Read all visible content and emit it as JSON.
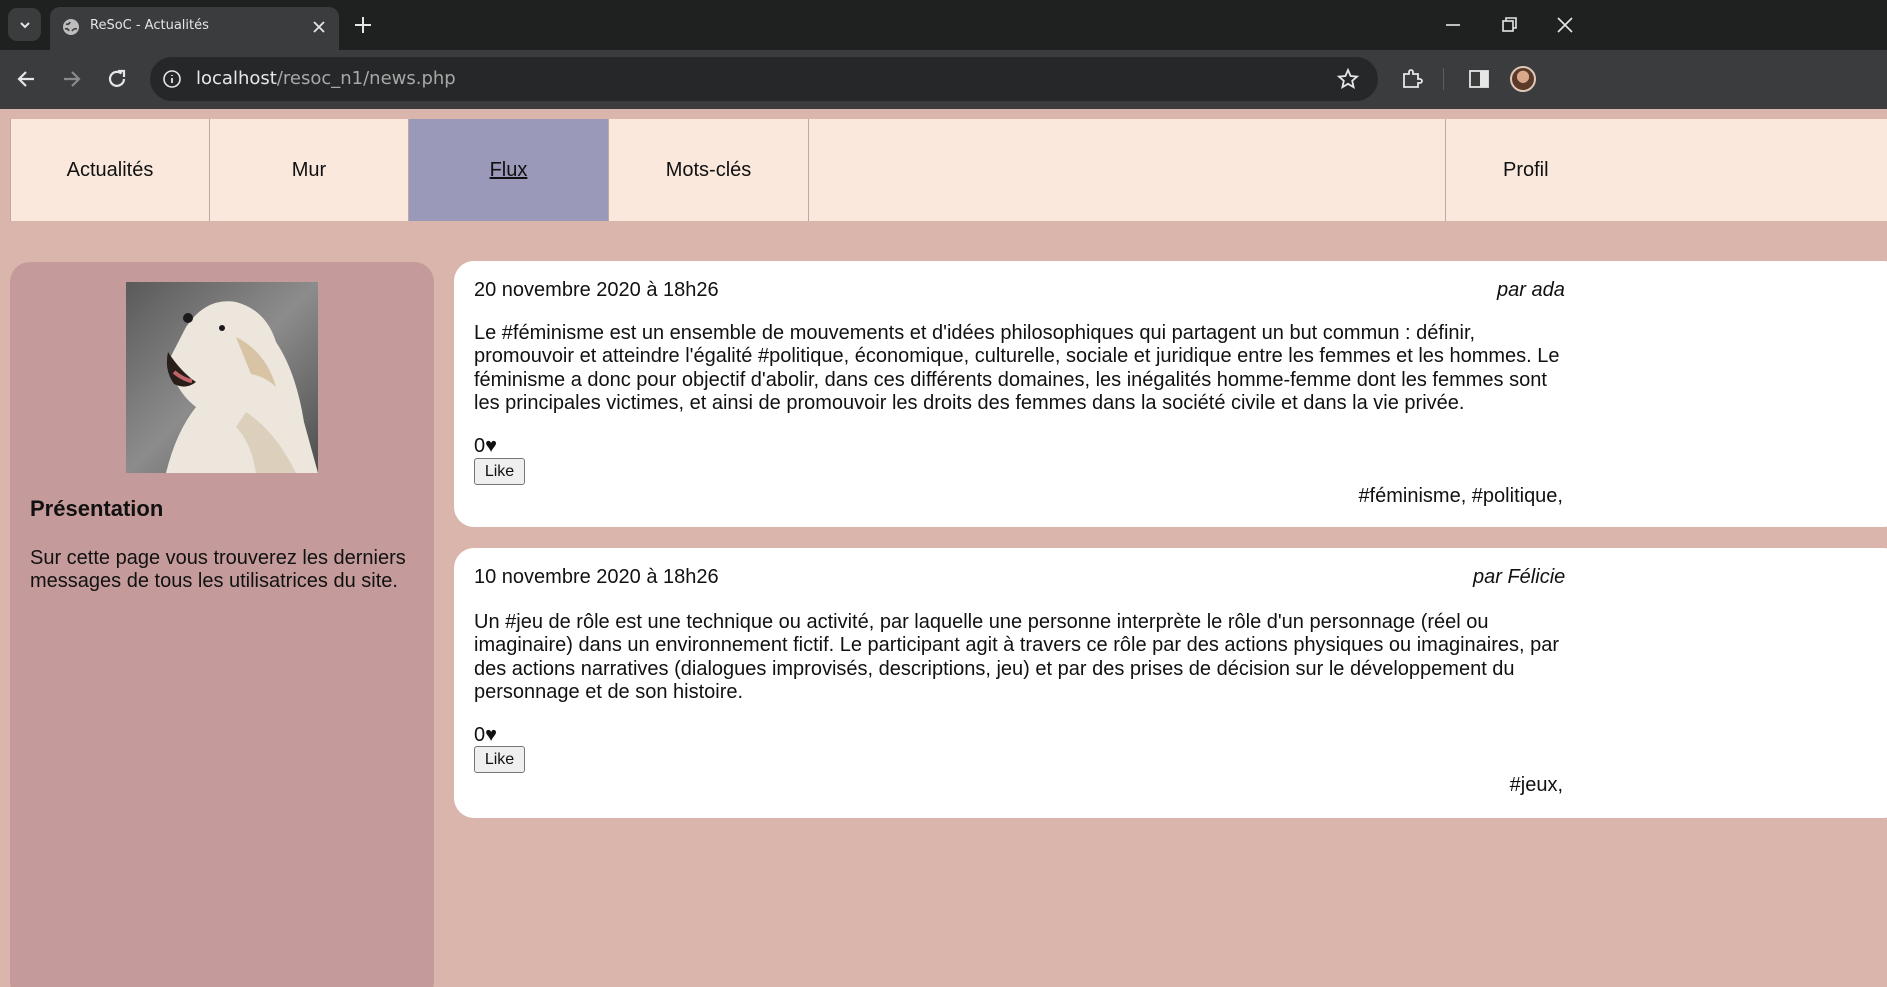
{
  "browser": {
    "tab_title": "ReSoC - Actualités",
    "url_host": "localhost",
    "url_path": "/resoc_n1/news.php"
  },
  "menu": {
    "items": [
      "Actualités",
      "Mur",
      "Flux",
      "Mots-clés"
    ],
    "active": "Flux",
    "profile": "Profil"
  },
  "sidebar": {
    "title": "Présentation",
    "text": "Sur cette page vous trouverez les derniers messages de tous les utilisatrices du site."
  },
  "posts": [
    {
      "date": "20 novembre 2020 à 18h26",
      "author": "par ada",
      "body": "Le #féminisme est un ensemble de mouvements et d'idées philosophiques qui partagent un but commun : définir, promouvoir et atteindre l'égalité #politique, économique, culturelle, sociale et juridique entre les femmes et les hommes. Le féminisme a donc pour objectif d'abolir, dans ces différents domaines, les inégalités homme-femme dont les femmes sont les principales victimes, et ainsi de promouvoir les droits des femmes dans la société civile et dans la vie privée.",
      "likes": "0♥",
      "like_label": "Like",
      "tags": "#féminisme, #politique,"
    },
    {
      "date": "10 novembre 2020 à 18h26",
      "author": "par Félicie",
      "body": "Un #jeu de rôle est une technique ou activité, par laquelle une personne interprète le rôle d'un personnage (réel ou imaginaire) dans un environnement fictif. Le participant agit à travers ce rôle par des actions physiques ou imaginaires, par des actions narratives (dialogues improvisés, descriptions, jeu) et par des prises de décision sur le développement du personnage et de son histoire.",
      "likes": "0♥",
      "like_label": "Like",
      "tags": "#jeux,"
    }
  ]
}
